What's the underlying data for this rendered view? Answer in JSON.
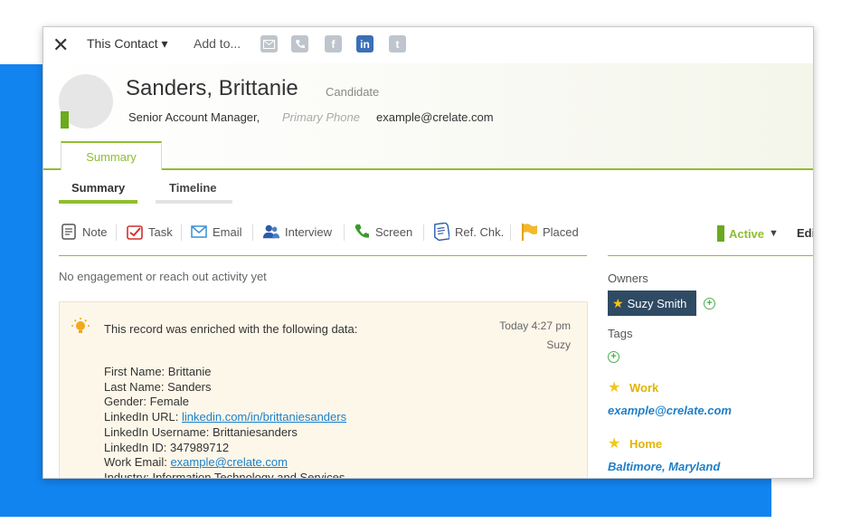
{
  "toolbar": {
    "close_glyph": "✕",
    "this_contact_label": "This Contact ▾",
    "add_to_label": "Add to...",
    "icons": [
      "email-icon",
      "phone-icon",
      "facebook-icon",
      "linkedin-icon",
      "twitter-icon"
    ],
    "facebook_glyph": "f",
    "linkedin_glyph": "in",
    "twitter_glyph": "t"
  },
  "contact": {
    "name": "Sanders, Brittanie",
    "role": "Candidate",
    "title": "Senior Account Manager,",
    "phone_placeholder": "Primary Phone",
    "email": "example@crelate.com"
  },
  "main_tab": "Summary",
  "subtabs": [
    "Summary",
    "Timeline"
  ],
  "actions": [
    {
      "label": "Note",
      "icon": "note-icon"
    },
    {
      "label": "Task",
      "icon": "task-icon"
    },
    {
      "label": "Email",
      "icon": "email-icon"
    },
    {
      "label": "Interview",
      "icon": "interview-icon"
    },
    {
      "label": "Screen",
      "icon": "phone-icon"
    },
    {
      "label": "Ref. Chk.",
      "icon": "reference-check-icon"
    },
    {
      "label": "Placed",
      "icon": "flag-icon"
    }
  ],
  "status": {
    "label": "Active",
    "edit_label": "Edi"
  },
  "engagement_text": "No engagement or reach out activity yet",
  "enrichment": {
    "title": "This record was enriched with the following data:",
    "time": "Today 4:27 pm",
    "author": "Suzy",
    "fields": {
      "first_name": "First Name: Brittanie",
      "last_name": "Last Name: Sanders",
      "gender": "Gender: Female",
      "linkedin_url_label": "LinkedIn URL: ",
      "linkedin_url": "linkedin.com/in/brittaniesanders",
      "linkedin_username": "LinkedIn Username: Brittaniesanders",
      "linkedin_id": "LinkedIn ID: 347989712",
      "work_email_label": "Work Email: ",
      "work_email": "example@crelate.com",
      "industry": "Industry: Information Technology and Services"
    }
  },
  "right_panel": {
    "owners_label": "Owners",
    "owner_name": "Suzy Smith",
    "tags_label": "Tags",
    "work_label": "Work",
    "work_email": "example@crelate.com",
    "home_label": "Home",
    "home_address": "Baltimore, Maryland"
  },
  "colors": {
    "accent_green": "#8fbe2f",
    "status_green": "#6aaa1e",
    "link_blue": "#1d7fc9",
    "background_blue": "#1284f0",
    "owner_chip": "#2f4a63",
    "star_yellow": "#f5c61a"
  }
}
